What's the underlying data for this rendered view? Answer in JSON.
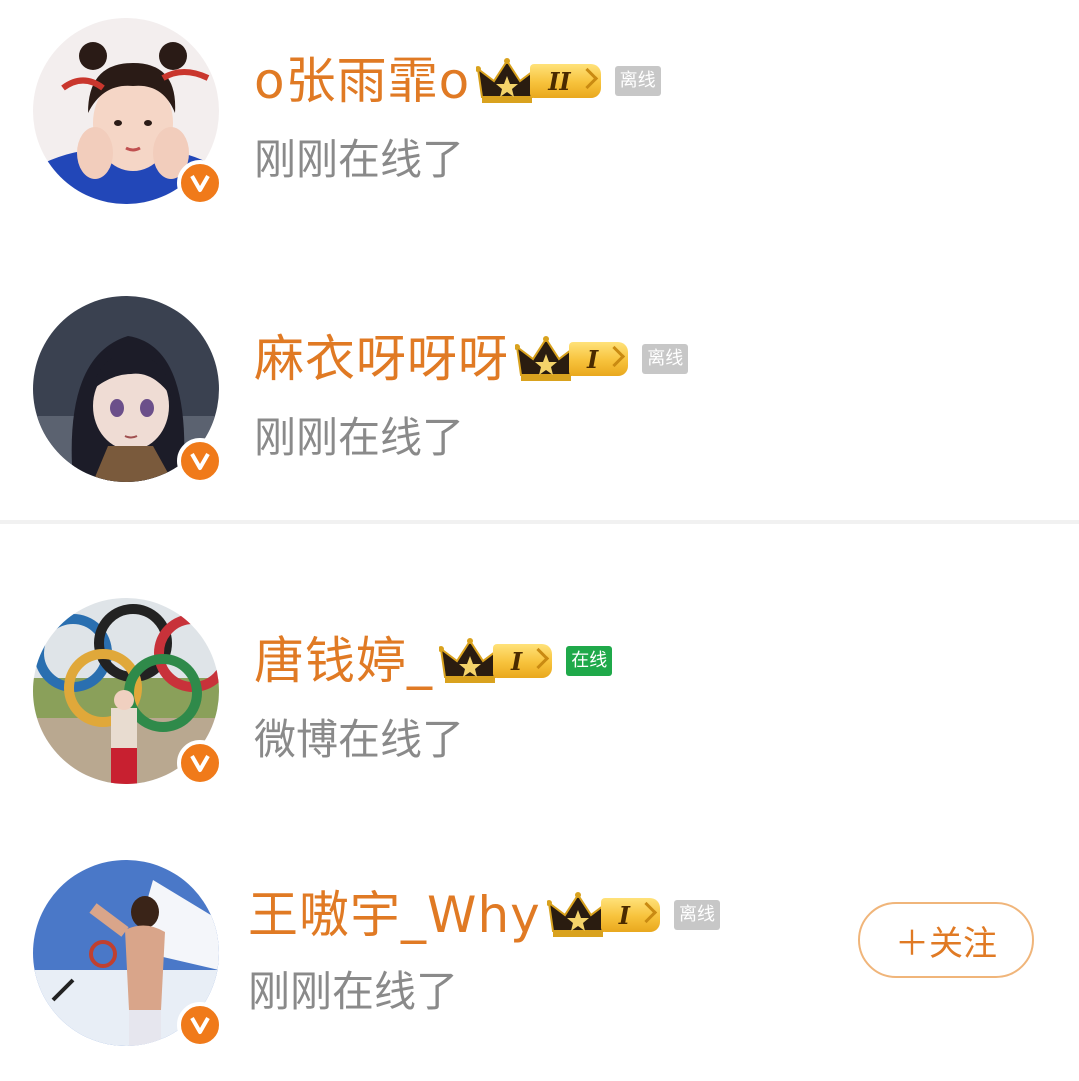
{
  "users": [
    {
      "name": "o张雨霏o",
      "level": "II",
      "status_label": "离线",
      "status": "offline",
      "activity": "刚刚在线了",
      "verified": true,
      "avatar_icon": "avatar-girl-icon"
    },
    {
      "name": "麻衣呀呀呀",
      "level": "I",
      "status_label": "离线",
      "status": "offline",
      "activity": "刚刚在线了",
      "verified": true,
      "avatar_icon": "avatar-anime-icon"
    },
    {
      "name": "唐钱婷_",
      "level": "I",
      "status_label": "在线",
      "status": "online",
      "activity": "微博在线了",
      "verified": true,
      "avatar_icon": "avatar-olympic-rings-icon"
    },
    {
      "name": "王嗷宇_Why",
      "level": "I",
      "status_label": "离线",
      "status": "offline",
      "activity": "刚刚在线了",
      "verified": true,
      "avatar_icon": "avatar-gymnast-icon"
    }
  ],
  "follow_button": {
    "label": "＋关注"
  },
  "colors": {
    "name": "#e07a24",
    "verified_badge": "#f07a1a",
    "online_tag": "#1fa94a",
    "offline_tag": "#c7c7c7",
    "subtitle": "#8a8a8a"
  }
}
